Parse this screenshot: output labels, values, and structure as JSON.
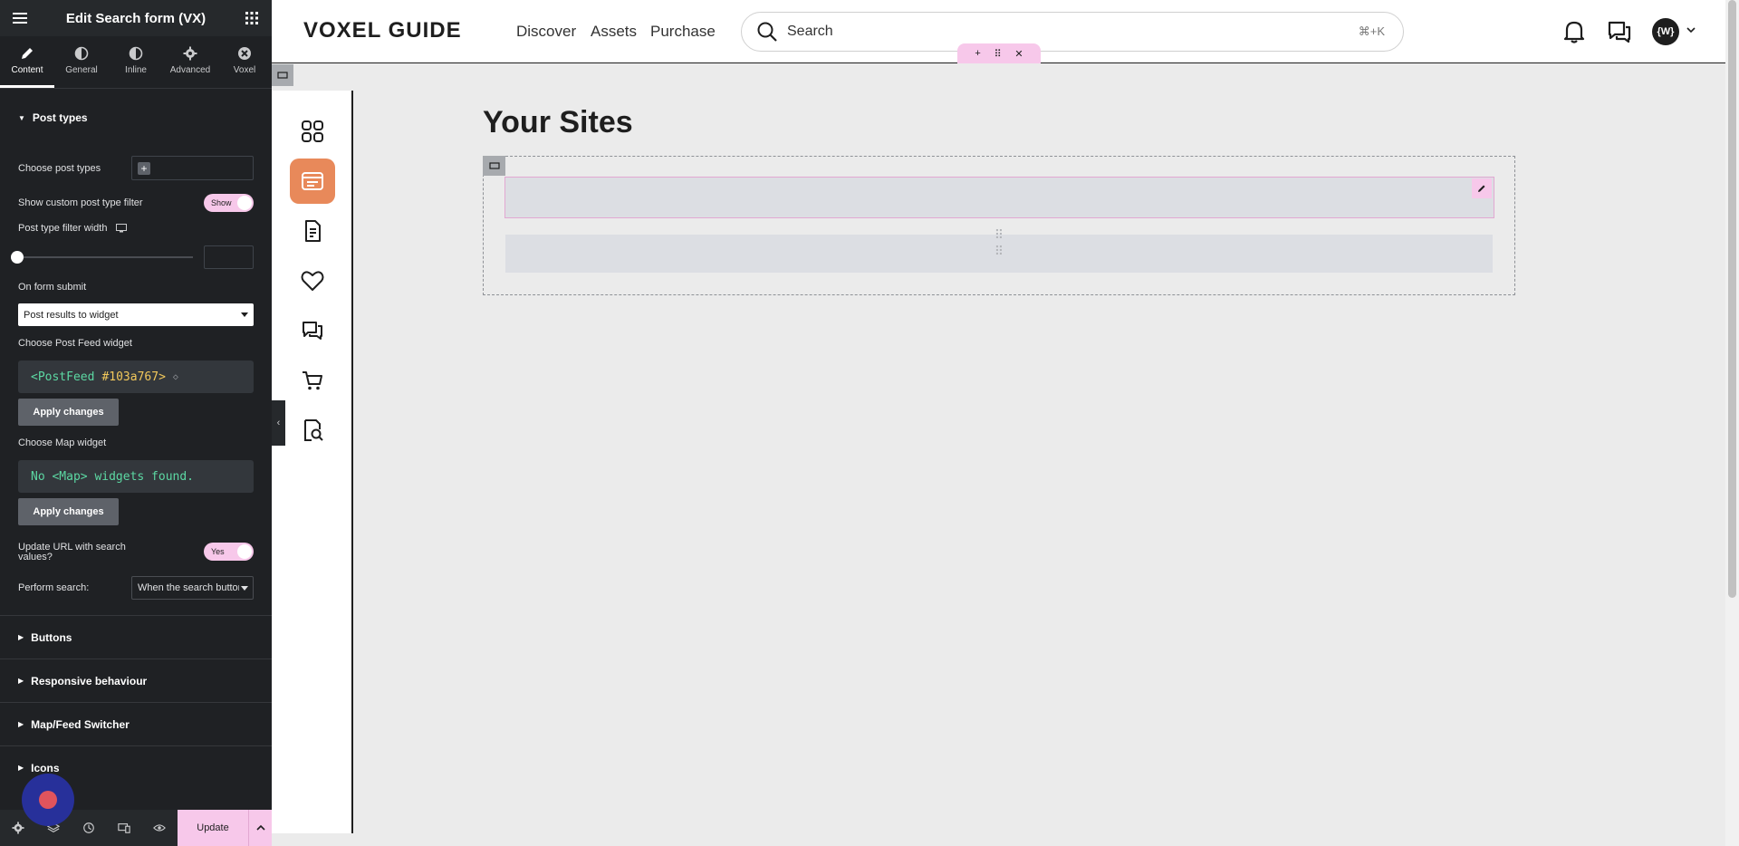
{
  "panel": {
    "title": "Edit Search form (VX)",
    "tabs": [
      {
        "label": "Content",
        "icon": "pencil-icon"
      },
      {
        "label": "General",
        "icon": "half-circle-icon"
      },
      {
        "label": "Inline",
        "icon": "half-circle-icon"
      },
      {
        "label": "Advanced",
        "icon": "gear-icon"
      },
      {
        "label": "Voxel",
        "icon": "voxel-icon"
      }
    ],
    "section_title": "Post types",
    "choose_post_types_label": "Choose post types",
    "show_filter_label": "Show custom post type filter",
    "show_filter_toggle": "Show",
    "filter_width_label": "Post type filter width",
    "on_submit_label": "On form submit",
    "on_submit_value": "Post results to widget",
    "post_feed_label": "Choose Post Feed widget",
    "post_feed_tag": "<PostFeed",
    "post_feed_id": "#103a767>",
    "apply_label": "Apply changes",
    "map_widget_label": "Choose Map widget",
    "map_widget_value": "No <Map> widgets found.",
    "update_url_label": "Update URL with search values?",
    "update_url_toggle": "Yes",
    "perform_search_label": "Perform search:",
    "perform_search_value": "When the search button is clicked",
    "collapsed_sections": [
      "Buttons",
      "Responsive behaviour",
      "Map/Feed Switcher",
      "Icons"
    ],
    "footer": {
      "update_label": "Update"
    }
  },
  "site": {
    "logo": "VOXEL GUIDE",
    "nav": [
      "Discover",
      "Assets",
      "Purchase"
    ],
    "search_placeholder": "Search",
    "search_shortcut": "⌘+K",
    "avatar_initials": "{W}",
    "page_title": "Your Sites"
  },
  "colors": {
    "accent_pink": "#f7c8ea",
    "rail_active": "#e8895a",
    "panel_bg": "#1f2124"
  }
}
